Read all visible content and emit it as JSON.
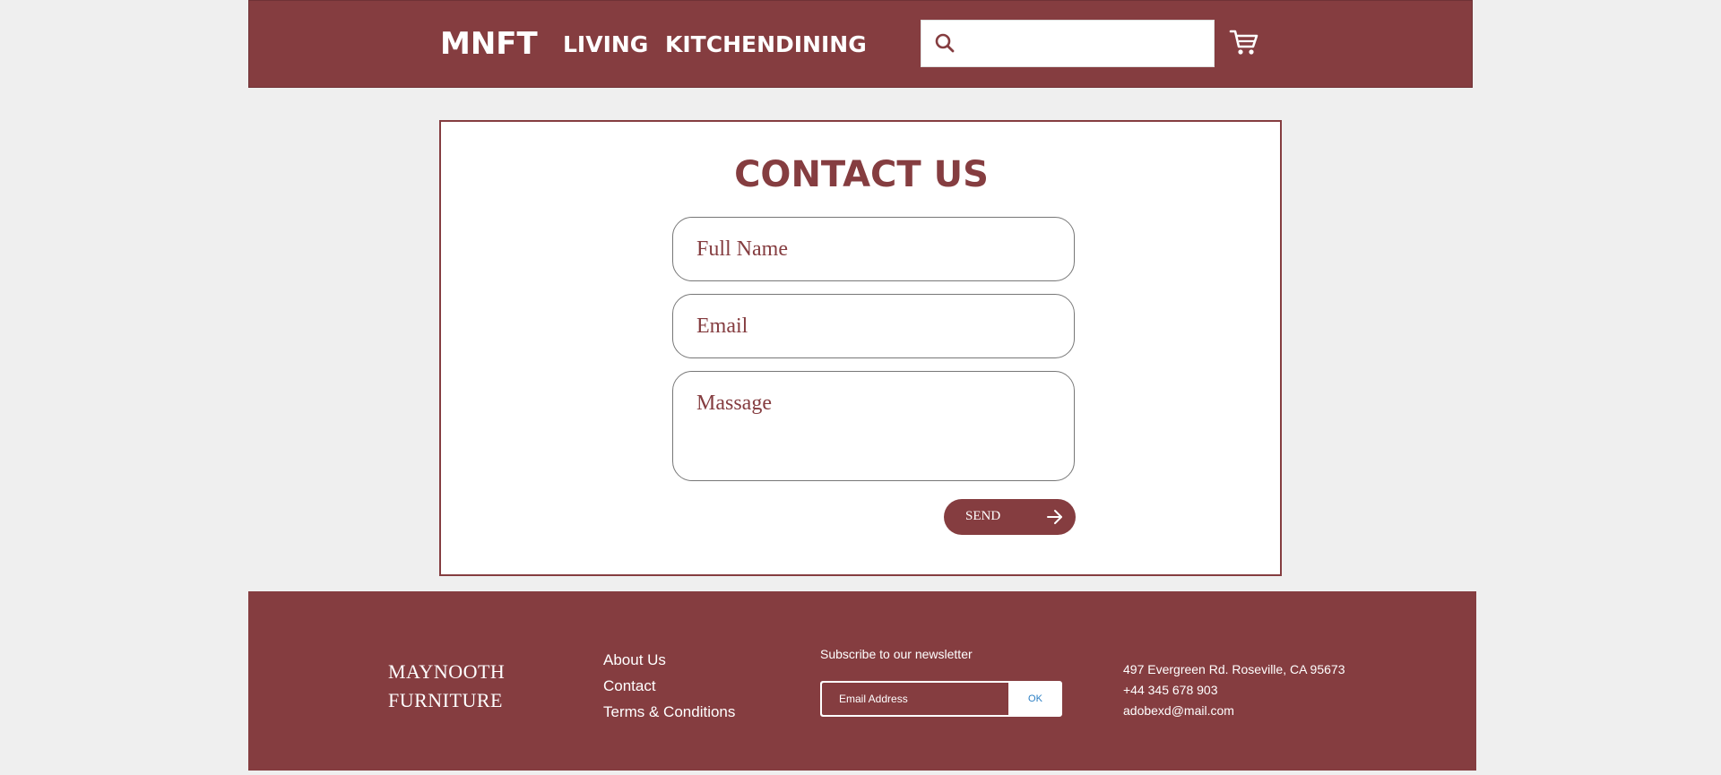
{
  "header": {
    "logo": "MNFT",
    "nav": [
      "LIVING",
      "KITCHEN",
      "DINING"
    ],
    "search": {
      "placeholder": "",
      "value": ""
    },
    "icons": {
      "search": "search-icon",
      "cart": "cart-icon"
    }
  },
  "contact": {
    "title": "CONTACT US",
    "full_name_placeholder": "Full Name",
    "email_placeholder": "Email",
    "message_placeholder": "Massage",
    "send_label": "SEND",
    "send_icon": "arrow-right-icon"
  },
  "footer": {
    "brand_line1": "MAYNOOTH",
    "brand_line2": "FURNITURE",
    "links": [
      "About Us",
      "Contact",
      "Terms & Conditions"
    ],
    "newsletter": {
      "label": "Subscribe to our newsletter",
      "placeholder": "Email Address",
      "ok_label": "OK"
    },
    "contact_info": {
      "address": "497 Evergreen Rd. Roseville, CA 95673",
      "phone": "+44 345 678 903",
      "email": "adobexd@mail.com"
    }
  },
  "colors": {
    "brand": "#853d40",
    "background": "#efefef",
    "ok_text": "#2b7fc4"
  }
}
